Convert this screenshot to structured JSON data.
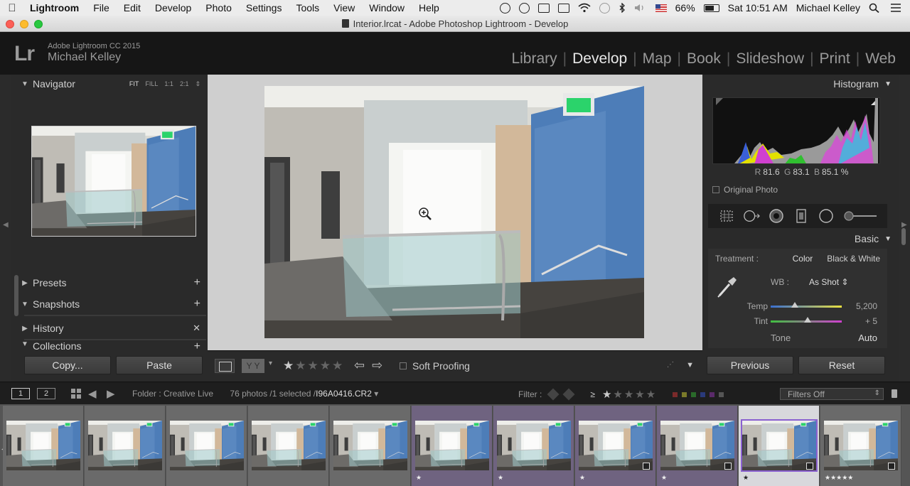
{
  "menubar": {
    "app_name": "Lightroom",
    "items": [
      "File",
      "Edit",
      "Develop",
      "Photo",
      "Settings",
      "Tools",
      "View",
      "Window",
      "Help"
    ],
    "battery": "66%",
    "clock": "Sat 10:51 AM",
    "user": "Michael Kelley"
  },
  "window": {
    "title": "Interior.lrcat - Adobe Photoshop Lightroom - Develop"
  },
  "identity": {
    "logo": "Lr",
    "version": "Adobe Lightroom CC 2015",
    "user": "Michael Kelley"
  },
  "modules": [
    "Library",
    "Develop",
    "Map",
    "Book",
    "Slideshow",
    "Print",
    "Web"
  ],
  "active_module": "Develop",
  "left_panel": {
    "navigator": {
      "title": "Navigator",
      "zoom": [
        "FIT",
        "FILL",
        "1:1",
        "2:1"
      ]
    },
    "presets": "Presets",
    "snapshots": "Snapshots",
    "history": "History",
    "collections": "Collections",
    "copy_button": "Copy...",
    "paste_button": "Paste"
  },
  "right_panel": {
    "histogram": {
      "title": "Histogram",
      "r_label": "R",
      "r": "81.6",
      "g_label": "G",
      "g": "83.1",
      "b_label": "B",
      "b": "85.1",
      "pct": "%"
    },
    "original_photo": "Original Photo",
    "basic": {
      "title": "Basic",
      "treatment_label": "Treatment :",
      "treatment_color": "Color",
      "treatment_bw": "Black & White",
      "wb_label": "WB :",
      "wb_value": "As Shot",
      "temp_label": "Temp",
      "temp_value": "5,200",
      "temp_position": 0.34,
      "tint_label": "Tint",
      "tint_value": "+ 5",
      "tint_position": 0.52,
      "tone_label": "Tone",
      "auto_label": "Auto"
    },
    "previous_button": "Previous",
    "reset_button": "Reset"
  },
  "toolbar": {
    "soft_proofing": "Soft Proofing",
    "stars": "★★★★★"
  },
  "filmbar": {
    "view1": "1",
    "view2": "2",
    "folder_label": "Folder : Creative Live",
    "count": "76 photos /1 selected /",
    "filename": "I96A0416.CR2",
    "filter_label": "Filter :",
    "filters_off": "Filters Off"
  },
  "filmstrip": [
    {
      "style": "plain",
      "star": "",
      "badge": false
    },
    {
      "style": "plain",
      "star": "",
      "badge": false
    },
    {
      "style": "plain",
      "star": "",
      "badge": false
    },
    {
      "style": "plain",
      "star": "",
      "badge": false
    },
    {
      "style": "plain",
      "star": "",
      "badge": false
    },
    {
      "style": "purple",
      "star": "★",
      "badge": false
    },
    {
      "style": "purple",
      "star": "★",
      "badge": false
    },
    {
      "style": "purple",
      "star": "★",
      "badge": true
    },
    {
      "style": "purple",
      "star": "★",
      "badge": true
    },
    {
      "style": "selected",
      "star": "★",
      "badge": true
    },
    {
      "style": "plain",
      "star": "★★★★★",
      "badge": true
    }
  ],
  "colors": {
    "accent": "#8a60d0",
    "panel": "#2a2a2a",
    "wall_blue": "#4d7db8"
  }
}
